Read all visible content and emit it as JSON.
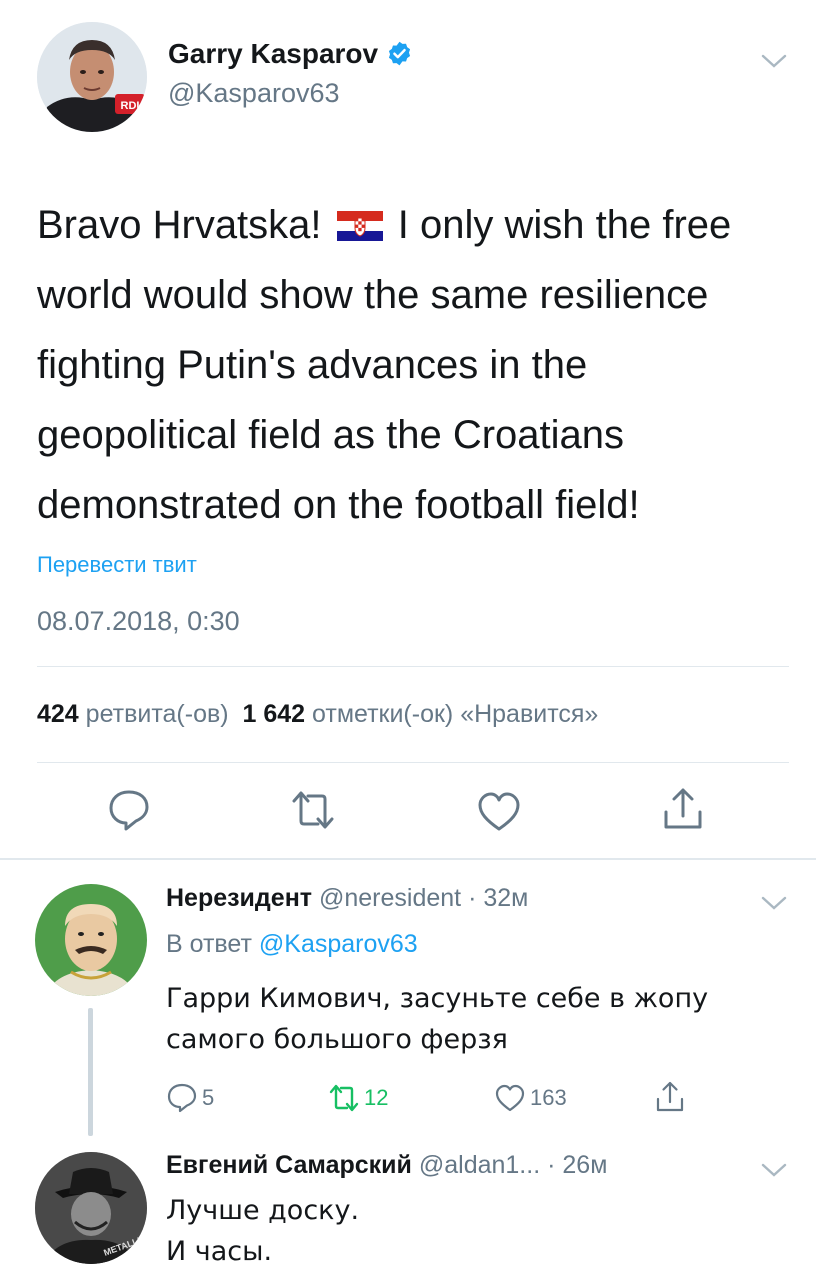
{
  "tweet": {
    "author_name": "Garry Kasparov",
    "author_handle": "@Kasparov63",
    "avatar_badge": "RDI",
    "text_part1": "Bravo Hrvatska! ",
    "text_part2": " I only wish the free world would show the same resilience fighting Putin's advances in the geopolitical field as the Croatians demonstrated on the football field!",
    "translate_label": "Перевести твит",
    "timestamp": "08.07.2018, 0:30",
    "retweet_count": "424",
    "retweet_label": "ретвита(-ов)",
    "like_count": "1 642",
    "like_label": "отметки(-ок) «Нравится»",
    "actions": [
      "reply-icon",
      "retweet-icon",
      "like-icon",
      "share-icon"
    ]
  },
  "replies": [
    {
      "name": "Нерезидент",
      "handle": "@neresident",
      "time": "· 32м",
      "reply_to_label": "В ответ",
      "reply_to_handle": "@Kasparov63",
      "text": "Гарри Кимович, засуньте себе в жопу самого большого ферзя",
      "reply_count": "5",
      "retweet_count": "12",
      "like_count": "163"
    },
    {
      "name": "Евгений Самарский",
      "handle": "@aldan1...",
      "time": "· 26м",
      "text_line1": "Лучше доску.",
      "text_line2": "И часы.",
      "avatar_text": "METALLICA"
    }
  ],
  "colors": {
    "accent": "#1da1f2",
    "secondary_text": "#657786",
    "retweet_active": "#17bf63",
    "divider": "#e1e8ed"
  }
}
